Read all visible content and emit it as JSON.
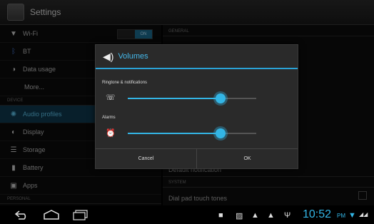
{
  "titlebar": {
    "title": "Settings",
    "icon": "settings-app-icon"
  },
  "sidebar": {
    "items": [
      {
        "label": "Wi-Fi",
        "icon": "wifi-icon",
        "toggle": {
          "off": "",
          "on": "ON"
        }
      },
      {
        "label": "BT",
        "icon": "bluetooth-icon"
      },
      {
        "label": "Data usage",
        "icon": "data-usage-icon"
      },
      {
        "label": "More..."
      },
      {
        "header": "DEVICE"
      },
      {
        "label": "Audio profiles",
        "icon": "audio-profiles-icon",
        "selected": true
      },
      {
        "label": "Display",
        "icon": "display-icon"
      },
      {
        "label": "Storage",
        "icon": "storage-icon"
      },
      {
        "label": "Battery",
        "icon": "battery-icon"
      },
      {
        "label": "Apps",
        "icon": "apps-icon"
      },
      {
        "header": "PERSONAL"
      }
    ]
  },
  "content": {
    "general_header": "GENERAL",
    "default_notification": "Default notification",
    "system_header": "SYSTEM",
    "dial_pad_touch_tones": "Dial pad touch tones"
  },
  "dialog": {
    "title": "Volumes",
    "title_icon": "volume-icon",
    "sliders": [
      {
        "label": "Ringtone & notifications",
        "icon": "ringtone-icon",
        "level": 0.72
      },
      {
        "label": "Alarms",
        "icon": "alarm-icon",
        "level": 0.72
      }
    ],
    "cancel_label": "Cancel",
    "ok_label": "OK",
    "accent": "#33b5e5"
  },
  "navbar": {
    "back_icon": "back-icon",
    "home_icon": "home-icon",
    "recents_icon": "recent-apps-icon",
    "status_icons": [
      "notification-icon",
      "gallery-icon",
      "warning-icon",
      "warning-icon",
      "usb-icon"
    ],
    "time": "10:52",
    "ampm": "PM"
  }
}
